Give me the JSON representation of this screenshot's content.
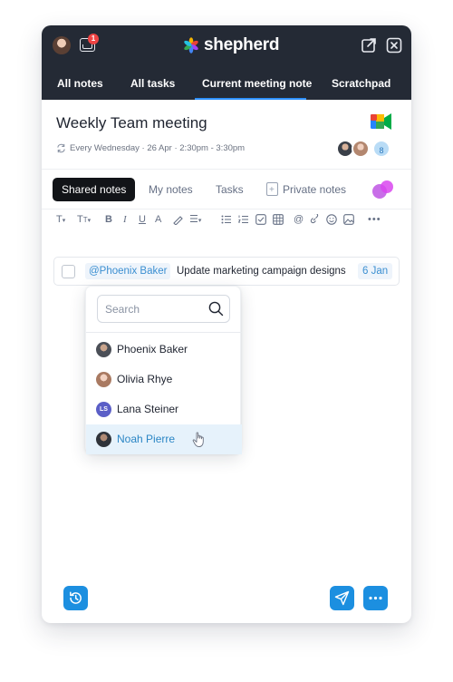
{
  "header": {
    "brand": "shepherd",
    "inbox_badge": "1",
    "colors": {
      "bar": "#242a35",
      "accent": "#2e90fa"
    }
  },
  "nav_tabs": [
    {
      "label": "All notes"
    },
    {
      "label": "All tasks"
    },
    {
      "label": "Current meeting note",
      "active": true
    },
    {
      "label": "Scratchpad"
    }
  ],
  "meeting": {
    "title": "Weekly Team meeting",
    "schedule": "Every Wednesday · 26 Apr · 2:30pm - 3:30pm",
    "attendee_count": "8"
  },
  "note_tabs": [
    {
      "label": "Shared notes",
      "active": true
    },
    {
      "label": "My notes"
    },
    {
      "label": "Tasks"
    },
    {
      "label": "Private notes"
    }
  ],
  "toolbar": {
    "icons": [
      "text-style-icon",
      "text-size-icon",
      "bold-icon",
      "italic-icon",
      "underline-icon",
      "text-color-icon",
      "highlight-icon",
      "align-icon",
      "bullet-list-icon",
      "numbered-list-icon",
      "checklist-icon",
      "table-icon",
      "mention-icon",
      "link-icon",
      "emoji-icon",
      "image-icon",
      "more-icon"
    ]
  },
  "task": {
    "mention": "@Phoenix Baker",
    "text": "Update marketing campaign designs",
    "due": "6 Jan"
  },
  "mention_menu": {
    "search_placeholder": "Search",
    "people": [
      {
        "name": "Phoenix Baker"
      },
      {
        "name": "Olivia Rhye"
      },
      {
        "name": "Lana Steiner",
        "initials": "LS"
      },
      {
        "name": "Noah Pierre",
        "highlighted": true
      }
    ]
  }
}
